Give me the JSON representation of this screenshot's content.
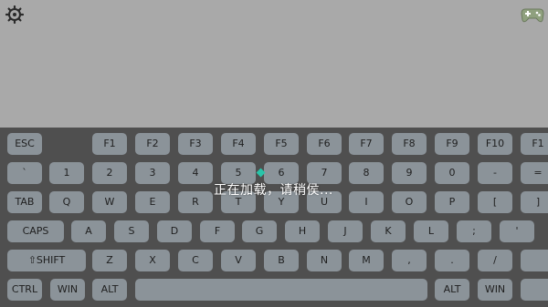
{
  "colors": {
    "background": "#a9a9a9",
    "keyboard_bg": "#4f4f4f",
    "key": "#8b9399",
    "accent": "#29c4a9"
  },
  "toolbar": {
    "settings_icon": "settings-gear-icon",
    "gamepad_icon": "gamepad-icon"
  },
  "status": {
    "loading_text": "正在加载，请稍侯..."
  },
  "keyboard": {
    "rows": [
      [
        "ESC",
        "F1",
        "F2",
        "F3",
        "F4",
        "F5",
        "F6",
        "F7",
        "F8",
        "F9",
        "F10",
        "F1"
      ],
      [
        "`",
        "1",
        "2",
        "3",
        "4",
        "5",
        "6",
        "7",
        "8",
        "9",
        "0",
        "-",
        "="
      ],
      [
        "TAB",
        "Q",
        "W",
        "E",
        "R",
        "T",
        "Y",
        "U",
        "I",
        "O",
        "P",
        "[",
        "]"
      ],
      [
        "CAPS",
        "A",
        "S",
        "D",
        "F",
        "G",
        "H",
        "J",
        "K",
        "L",
        ";",
        "'"
      ],
      [
        "⇧SHIFT",
        "Z",
        "X",
        "C",
        "V",
        "B",
        "N",
        "M",
        ",",
        ".",
        "/"
      ],
      [
        "CTRL",
        "WIN",
        "ALT",
        "",
        "ALT",
        "WIN"
      ]
    ]
  }
}
